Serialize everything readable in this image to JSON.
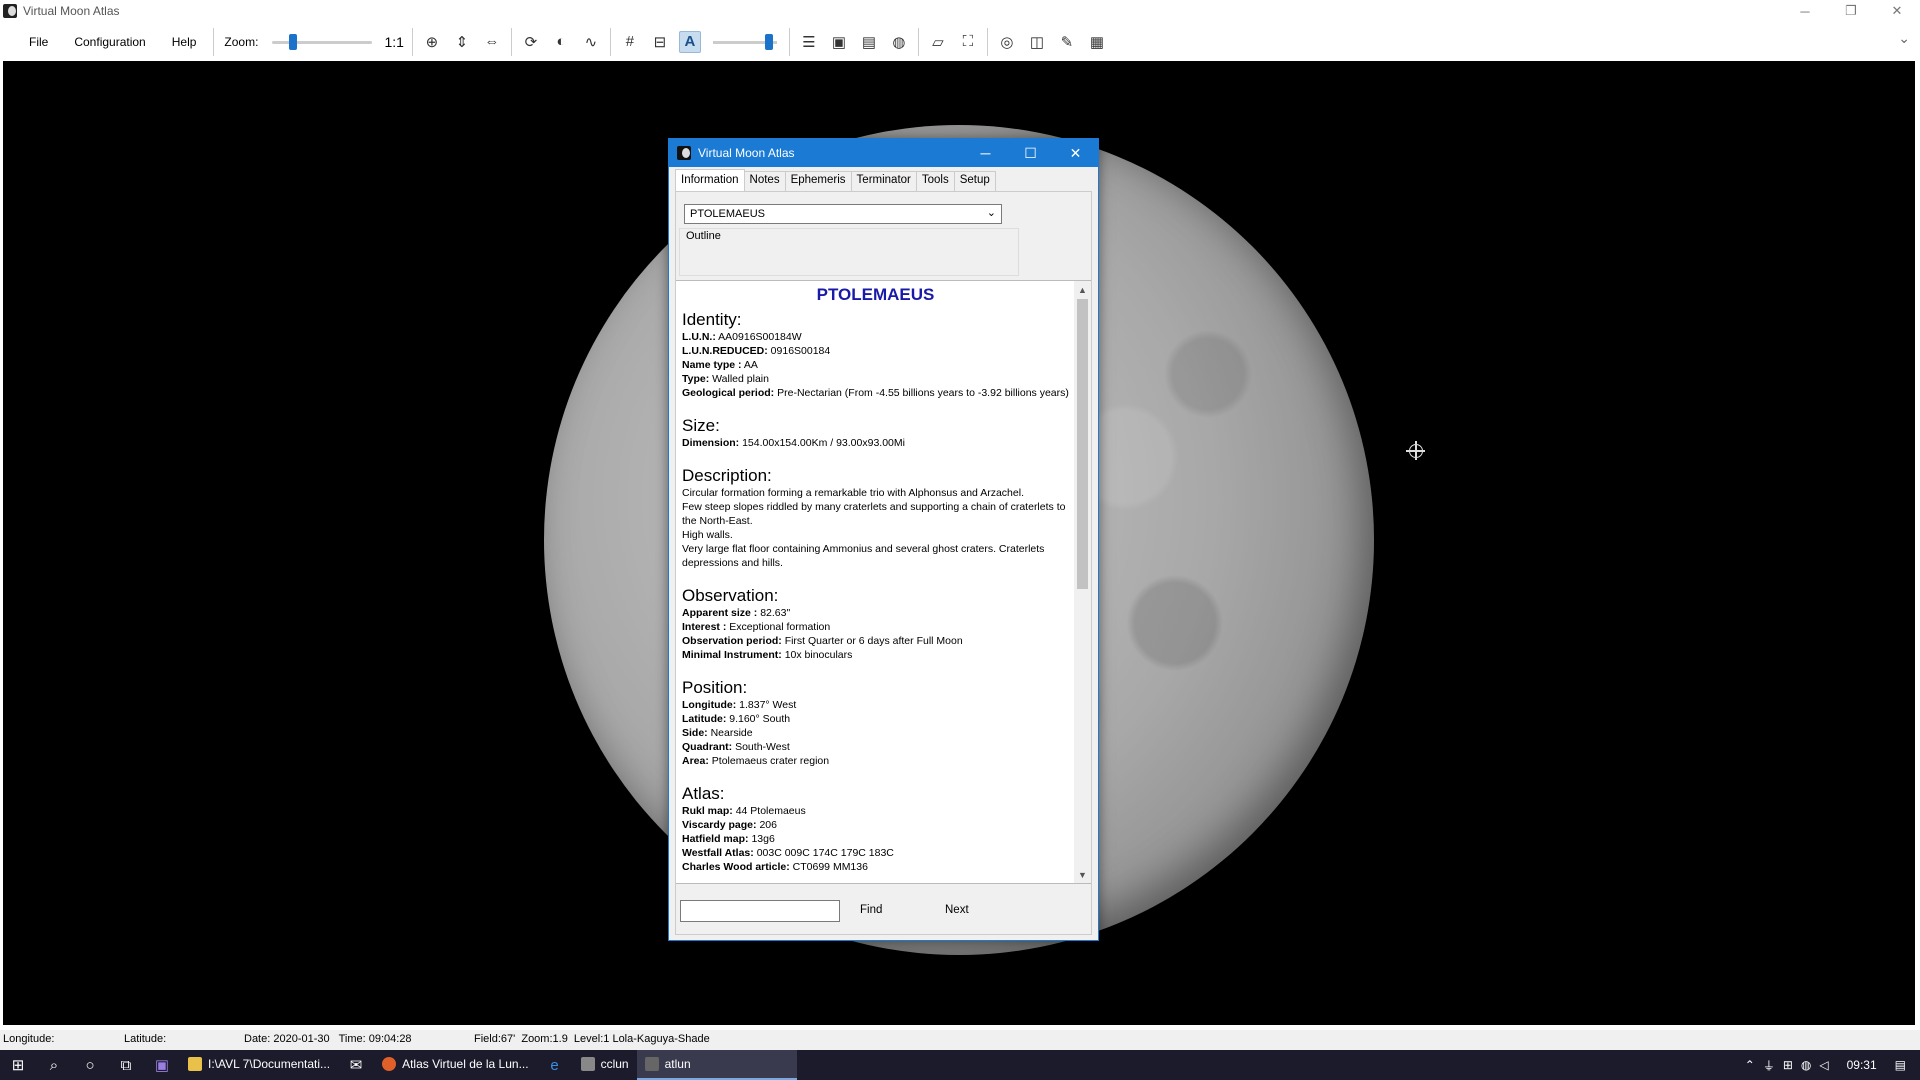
{
  "window": {
    "title": "Virtual Moon Atlas"
  },
  "menu": {
    "file": "File",
    "configuration": "Configuration",
    "help": "Help"
  },
  "toolbar": {
    "zoom_label": "Zoom:",
    "ratio": "1:1",
    "zoom_fraction": 0.18
  },
  "dialog": {
    "title": "Virtual Moon Atlas",
    "tabs": [
      "Information",
      "Notes",
      "Ephemeris",
      "Terminator",
      "Tools",
      "Setup"
    ],
    "selected_formation": "PTOLEMAEUS",
    "outline_label": "Outline",
    "heading": "PTOLEMAEUS",
    "identity": {
      "title": "Identity:",
      "lun_label": "L.U.N.:",
      "lun": "AA0916S00184W",
      "lun_reduced_label": "L.U.N.REDUCED:",
      "lun_reduced": "0916S00184",
      "name_type_label": "Name type :",
      "name_type": "AA",
      "type_label": "Type:",
      "type": "Walled plain",
      "geo_label": "Geological period:",
      "geo": "Pre-Nectarian (From -4.55 billions years to -3.92 billions years)"
    },
    "size": {
      "title": "Size:",
      "dimension_label": "Dimension:",
      "dimension": "154.00x154.00Km / 93.00x93.00Mi"
    },
    "description": {
      "title": "Description:",
      "lines": [
        "Circular formation forming a remarkable trio with Alphonsus and Arzachel.",
        "Few steep slopes riddled by many craterlets and supporting a chain of craterlets to the North-East.",
        "High walls.",
        "Very large flat floor containing Ammonius and several ghost craters. Craterlets depressions and hills."
      ]
    },
    "observation": {
      "title": "Observation:",
      "apparent_label": "Apparent size :",
      "apparent": "82.63\"",
      "interest_label": "Interest :",
      "interest": "Exceptional formation",
      "period_label": "Observation period:",
      "period": "First Quarter or 6 days after Full Moon",
      "instrument_label": "Minimal Instrument:",
      "instrument": "10x binoculars"
    },
    "position": {
      "title": "Position:",
      "longitude_label": "Longitude:",
      "longitude": "1.837° West",
      "latitude_label": "Latitude:",
      "latitude": "9.160° South",
      "side_label": "Side:",
      "side": "Nearside",
      "quadrant_label": "Quadrant:",
      "quadrant": "South-West",
      "area_label": "Area:",
      "area": "Ptolemaeus crater region"
    },
    "atlas": {
      "title": "Atlas:",
      "rukl_label": "Rukl map:",
      "rukl": "44 Ptolemaeus",
      "viscardy_label": "Viscardy page:",
      "viscardy": "206",
      "hatfield_label": "Hatfield map:",
      "hatfield": "13g6",
      "westfall_label": "Westfall Atlas:",
      "westfall": "003C 009C 174C 179C 183C",
      "wood_label": "Charles Wood article:",
      "wood": "CT0699 MM136"
    },
    "find_label": "Find",
    "next_label": "Next"
  },
  "status": {
    "longitude": "Longitude:",
    "latitude": "Latitude:",
    "datetime": "Date: 2020-01-30   Time: 09:04:28",
    "field": "Field:67'  Zoom:1.9  Level:1 Lola-Kaguya-Shade"
  },
  "taskbar": {
    "apps": [
      "I:\\AVL 7\\Documentati...",
      "Atlas Virtuel de la Lun...",
      "cclun",
      "atlun"
    ],
    "clock": "09:31"
  },
  "colors": {
    "accent": "#1a7ad4",
    "heading": "#1a1aa8",
    "taskbar": "#1b1b2b"
  }
}
